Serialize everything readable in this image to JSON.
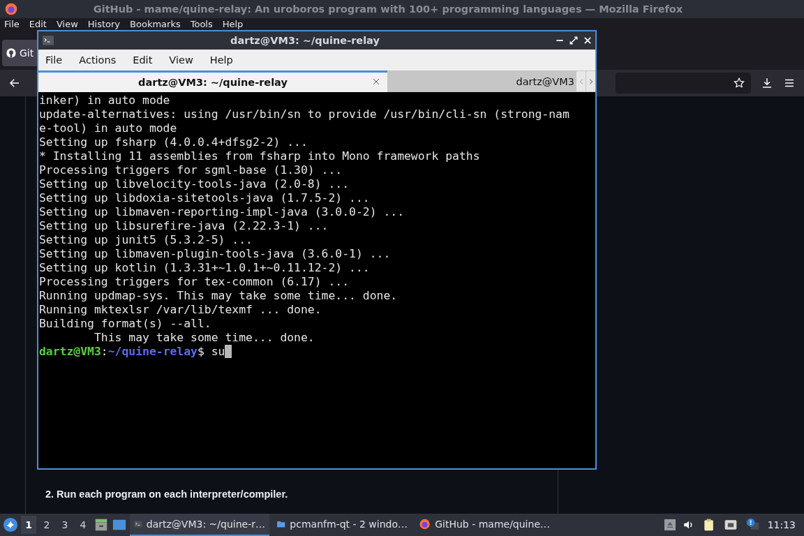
{
  "firefox": {
    "title": "GitHub - mame/quine-relay: An uroboros program with 100+ programming languages — Mozilla Firefox",
    "menu": [
      {
        "label": "File"
      },
      {
        "label": "Edit"
      },
      {
        "label": "View"
      },
      {
        "label": "History"
      },
      {
        "label": "Bookmarks"
      },
      {
        "label": "Tools"
      },
      {
        "label": "Help"
      }
    ],
    "tab": {
      "label": "Git"
    },
    "content": {
      "heading": "2. Run each program on each interpreter/compiler."
    }
  },
  "terminal": {
    "title": "dartz@VM3: ~/quine-relay",
    "menu": [
      {
        "label": "File"
      },
      {
        "label": "Actions"
      },
      {
        "label": "Edit"
      },
      {
        "label": "View"
      },
      {
        "label": "Help"
      }
    ],
    "tabs": [
      {
        "label": "dartz@VM3: ~/quine-relay",
        "selected": true
      },
      {
        "label": "dartz@VM3",
        "selected": false
      }
    ],
    "lines": [
      "inker) in auto mode",
      "update-alternatives: using /usr/bin/sn to provide /usr/bin/cli-sn (strong-nam",
      "e-tool) in auto mode",
      "Setting up fsharp (4.0.0.4+dfsg2-2) ...",
      "* Installing 11 assemblies from fsharp into Mono framework paths",
      "Processing triggers for sgml-base (1.30) ...",
      "Setting up libvelocity-tools-java (2.0-8) ...",
      "Setting up libdoxia-sitetools-java (1.7.5-2) ...",
      "Setting up libmaven-reporting-impl-java (3.0.0-2) ...",
      "Setting up libsurefire-java (2.22.3-1) ...",
      "Setting up junit5 (5.3.2-5) ...",
      "Setting up libmaven-plugin-tools-java (3.6.0-1) ...",
      "Setting up kotlin (1.3.31+~1.0.1+~0.11.12-2) ...",
      "Processing triggers for tex-common (6.17) ...",
      "Running updmap-sys. This may take some time... done.",
      "Running mktexlsr /var/lib/texmf ... done.",
      "Building format(s) --all.",
      "        This may take some time... done."
    ],
    "prompt": {
      "user": "dartz@VM3",
      "separator": ":",
      "path": "~/quine-relay",
      "symbol": "$",
      "command": "su"
    }
  },
  "taskbar": {
    "desktops": [
      {
        "label": "1",
        "selected": true
      },
      {
        "label": "2",
        "selected": false
      },
      {
        "label": "3",
        "selected": false
      },
      {
        "label": "4",
        "selected": false
      }
    ],
    "tasks": [
      {
        "label": "dartz@VM3: ~/quine-r…",
        "selected": true,
        "kind": "terminal"
      },
      {
        "label": "pcmanfm-qt - 2 windo…",
        "selected": false,
        "kind": "folder"
      },
      {
        "label": "GitHub - mame/quine…",
        "selected": false,
        "kind": "browser"
      }
    ],
    "clock": "11:13"
  }
}
